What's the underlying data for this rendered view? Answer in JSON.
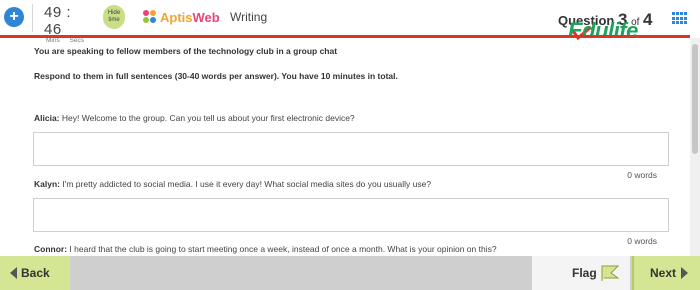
{
  "header": {
    "plus_icon_glyph": "+",
    "timer": {
      "minutes": "49",
      "separator": ":",
      "seconds": "46",
      "minutes_label": "Mins",
      "seconds_label": "Secs"
    },
    "hide_time_label": "Hide time",
    "logo": {
      "prefix": "Aptis",
      "suffix": "Web"
    },
    "section_name": "Writing",
    "question": {
      "word": "Question",
      "current": "3",
      "of": "of",
      "total": "4"
    },
    "watermark": "Edulife"
  },
  "instructions": {
    "line1": "You are speaking to fellow members of the technology club in a group chat",
    "line2": "Respond to them in full sentences (30-40 words per answer). You have 10 minutes in total."
  },
  "questions": [
    {
      "speaker": "Alicia:",
      "text": "Hey! Welcome to the group. Can you tell us about your first electronic device?",
      "answer": "",
      "word_count": "0 words"
    },
    {
      "speaker": "Kalyn:",
      "text": "I'm pretty addicted to social media. I use it every day! What social media sites do you usually use?",
      "answer": "",
      "word_count": "0 words"
    },
    {
      "speaker": "Connor:",
      "text": "I heard that the club is going to start meeting once a week, instead of once a month. What is your opinion on this?"
    }
  ],
  "footer": {
    "back_label": "Back",
    "flag_label": "Flag",
    "next_label": "Next"
  },
  "colors": {
    "accent_red": "#d9362a",
    "button_green": "#d4e593",
    "timer_blue": "#2f86d6",
    "watermark_green": "#1fa35c"
  },
  "icons": [
    "plus-icon",
    "grid-icon",
    "flag-icon",
    "arrow-left-icon",
    "arrow-right-icon"
  ]
}
